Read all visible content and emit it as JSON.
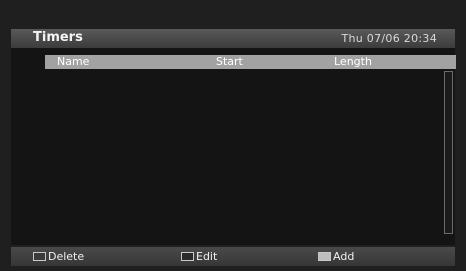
{
  "header": {
    "title": "Timers",
    "datetime": "Thu 07/06 20:34"
  },
  "table": {
    "columns": [
      "Name",
      "Start",
      "Length"
    ],
    "rows": []
  },
  "footer": {
    "keys": [
      {
        "label": "Delete",
        "color": "#3a3a3a"
      },
      {
        "label": "Edit",
        "color": "#2a2a2a"
      },
      {
        "label": "Add",
        "color": "#bdbdbd"
      }
    ]
  }
}
